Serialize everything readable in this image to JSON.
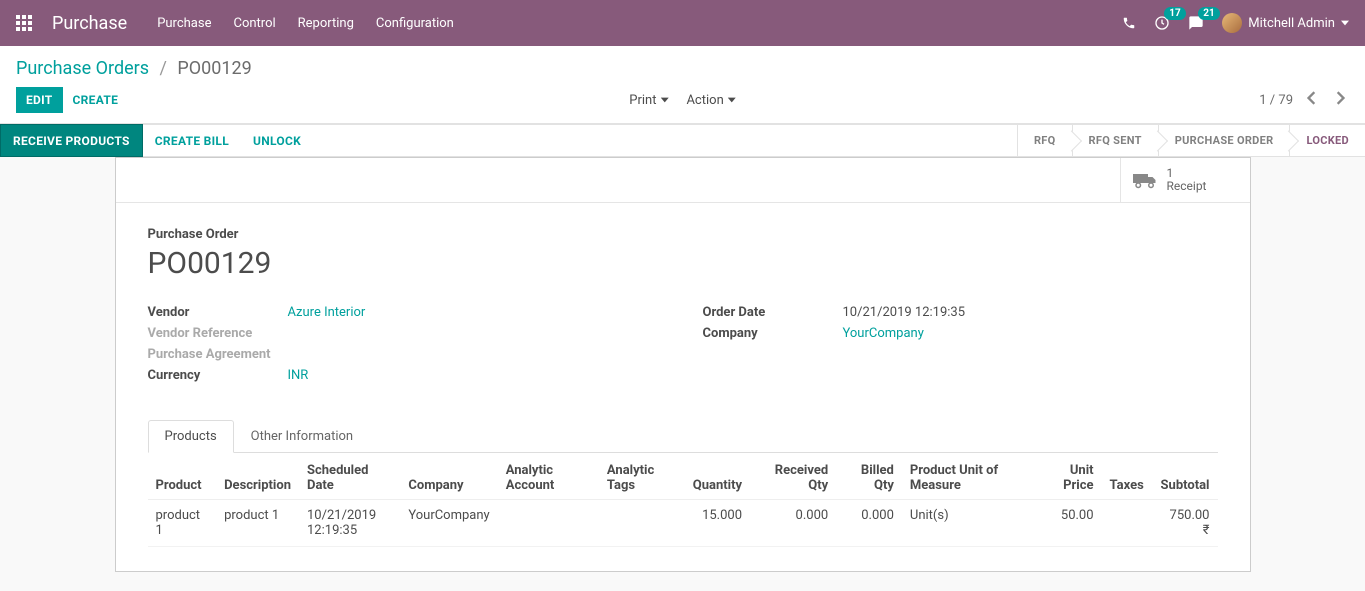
{
  "navbar": {
    "app_name": "Purchase",
    "menu": [
      "Purchase",
      "Control",
      "Reporting",
      "Configuration"
    ],
    "clock_badge": "17",
    "chat_badge": "21",
    "user_name": "Mitchell Admin"
  },
  "breadcrumb": {
    "parent": "Purchase Orders",
    "current": "PO00129"
  },
  "buttons": {
    "edit": "EDIT",
    "create": "CREATE",
    "print": "Print",
    "action": "Action"
  },
  "pager": {
    "text": "1 / 79"
  },
  "statusbar": {
    "receive": "RECEIVE PRODUCTS",
    "create_bill": "CREATE BILL",
    "unlock": "UNLOCK",
    "steps": [
      "RFQ",
      "RFQ SENT",
      "PURCHASE ORDER",
      "LOCKED"
    ],
    "active_step": "LOCKED"
  },
  "stat_button": {
    "count": "1",
    "label": "Receipt"
  },
  "form": {
    "header_label": "Purchase Order",
    "name": "PO00129",
    "left_fields": [
      {
        "label": "Vendor",
        "value": "Azure Interior",
        "link": true,
        "muted": false
      },
      {
        "label": "Vendor Reference",
        "value": "",
        "link": false,
        "muted": true
      },
      {
        "label": "Purchase Agreement",
        "value": "",
        "link": false,
        "muted": true
      },
      {
        "label": "Currency",
        "value": "INR",
        "link": true,
        "muted": false
      }
    ],
    "right_fields": [
      {
        "label": "Order Date",
        "value": "10/21/2019 12:19:35",
        "link": false
      },
      {
        "label": "Company",
        "value": "YourCompany",
        "link": true
      }
    ]
  },
  "tabs": {
    "products": "Products",
    "other": "Other Information"
  },
  "table": {
    "headers": {
      "product": "Product",
      "description": "Description",
      "scheduled_date": "Scheduled Date",
      "company": "Company",
      "analytic_account": "Analytic Account",
      "analytic_tags": "Analytic Tags",
      "quantity": "Quantity",
      "received_qty": "Received Qty",
      "billed_qty": "Billed Qty",
      "uom": "Product Unit of Measure",
      "unit_price": "Unit Price",
      "taxes": "Taxes",
      "subtotal": "Subtotal"
    },
    "rows": [
      {
        "product": "product 1",
        "description": "product 1",
        "scheduled_date": "10/21/2019 12:19:35",
        "company": "YourCompany",
        "analytic_account": "",
        "analytic_tags": "",
        "quantity": "15.000",
        "received_qty": "0.000",
        "billed_qty": "0.000",
        "uom": "Unit(s)",
        "unit_price": "50.00",
        "taxes": "",
        "subtotal": "750.00 ₹"
      }
    ]
  }
}
